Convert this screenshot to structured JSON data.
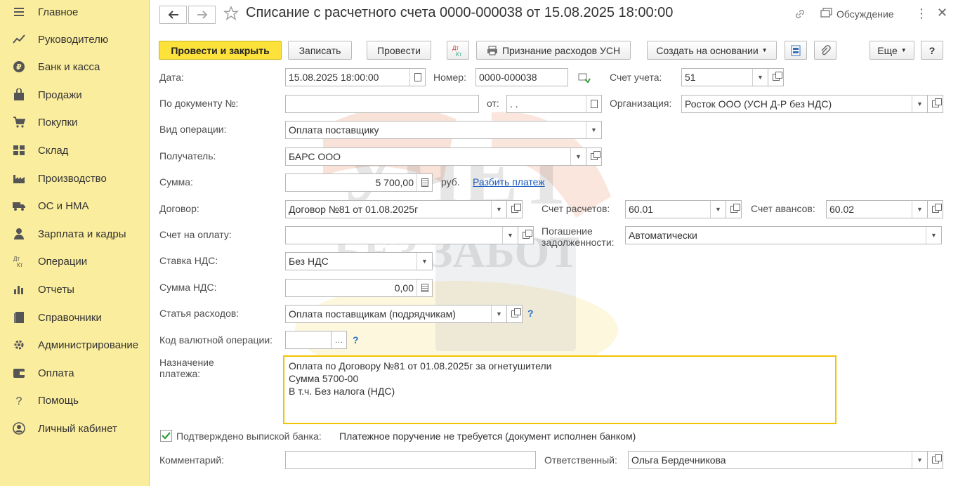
{
  "sidebar": {
    "items": [
      {
        "label": "Главное",
        "icon": "menu-icon"
      },
      {
        "label": "Руководителю",
        "icon": "trend-icon"
      },
      {
        "label": "Банк и касса",
        "icon": "ruble-icon"
      },
      {
        "label": "Продажи",
        "icon": "bag-icon"
      },
      {
        "label": "Покупки",
        "icon": "cart-icon"
      },
      {
        "label": "Склад",
        "icon": "warehouse-icon"
      },
      {
        "label": "Производство",
        "icon": "factory-icon"
      },
      {
        "label": "ОС и НМА",
        "icon": "truck-icon"
      },
      {
        "label": "Зарплата и кадры",
        "icon": "person-icon"
      },
      {
        "label": "Операции",
        "icon": "dt-kt-icon"
      },
      {
        "label": "Отчеты",
        "icon": "bar-chart-icon"
      },
      {
        "label": "Справочники",
        "icon": "book-icon"
      },
      {
        "label": "Администрирование",
        "icon": "gear-icon"
      },
      {
        "label": "Оплата",
        "icon": "wallet-icon"
      },
      {
        "label": "Помощь",
        "icon": "question-icon"
      },
      {
        "label": "Личный кабинет",
        "icon": "user-circle-icon"
      }
    ]
  },
  "header": {
    "title": "Списание с расчетного счета 0000-000038 от 15.08.2025 18:00:00",
    "discussion": "Обсуждение"
  },
  "toolbar": {
    "post_close": "Провести и закрыть",
    "save": "Записать",
    "post": "Провести",
    "dt_kt": "Дт Кт",
    "usn": "Признание расходов УСН",
    "create_based": "Создать на основании",
    "more": "Еще",
    "help": "?"
  },
  "form": {
    "date_label": "Дата:",
    "date_value": "15.08.2025 18:00:00",
    "number_label": "Номер:",
    "number_value": "0000-000038",
    "account_label": "Счет учета:",
    "account_value": "51",
    "doc_no_label": "По документу №:",
    "doc_no_value": "",
    "from_label": "от:",
    "from_value": " .  .",
    "org_label": "Организация:",
    "org_value": "Росток ООО (УСН Д-Р без НДС)",
    "op_type_label": "Вид операции:",
    "op_type_value": "Оплата поставщику",
    "recipient_label": "Получатель:",
    "recipient_value": "БАРС ООО",
    "sum_label": "Сумма:",
    "sum_value": "5 700,00",
    "currency": "руб.",
    "split_link": "Разбить платеж",
    "contract_label": "Договор:",
    "contract_value": "Договор №81 от 01.08.2025г",
    "settle_acc_label": "Счет расчетов:",
    "settle_acc_value": "60.01",
    "advance_acc_label": "Счет авансов:",
    "advance_acc_value": "60.02",
    "invoice_label": "Счет на оплату:",
    "invoice_value": "",
    "repayment_label_1": "Погашение",
    "repayment_label_2": "задолженности:",
    "repayment_value": "Автоматически",
    "vat_rate_label": "Ставка НДС:",
    "vat_rate_value": "Без НДС",
    "vat_sum_label": "Сумма НДС:",
    "vat_sum_value": "0,00",
    "expense_label": "Статья расходов:",
    "expense_value": "Оплата поставщикам (подрядчикам)",
    "currency_op_label": "Код валютной операции:",
    "currency_op_value": "",
    "purpose_label_1": "Назначение",
    "purpose_label_2": "платежа:",
    "purpose_line_1": "Оплата по Договору №81 от 01.08.2025г за огнетушители",
    "purpose_line_2": "Сумма 5700-00",
    "purpose_line_3": "В т.ч. Без налога (НДС)",
    "confirmed_label": "Подтверждено выпиской банка:",
    "confirmed_checked": true,
    "payment_order_note": "Платежное поручение не требуется (документ исполнен банком)",
    "comment_label": "Комментарий:",
    "comment_value": "",
    "responsible_label": "Ответственный:",
    "responsible_value": "Ольга Бердечникова"
  },
  "watermark": {
    "line1": "УЧЕТ",
    "line2": "БЕЗ ЗАБОТ"
  },
  "colors": {
    "sidebar_bg": "#fbed9e",
    "primary_button": "#fde23b",
    "focus_border": "#f2c400",
    "link": "#1a5bbf"
  }
}
